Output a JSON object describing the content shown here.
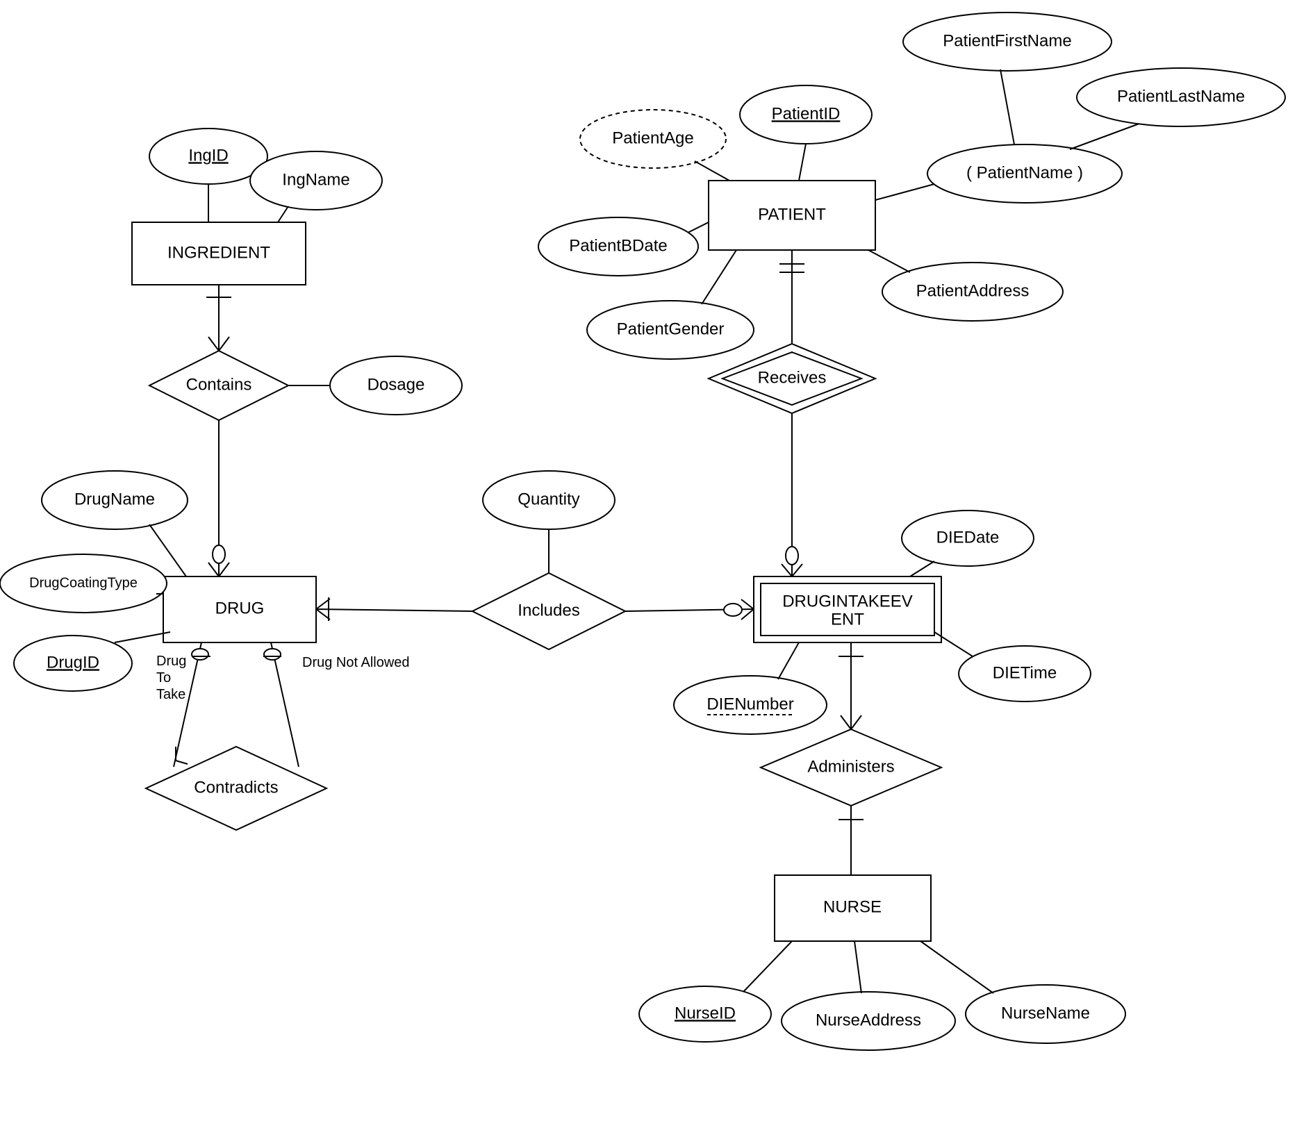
{
  "entities": {
    "ingredient": "INGREDIENT",
    "drug": "DRUG",
    "patient": "PATIENT",
    "drugintake": "DRUGINTAKEEV",
    "drugintake2": "ENT",
    "nurse": "NURSE"
  },
  "attributes": {
    "ingid": "IngID",
    "ingname": "IngName",
    "dosage": "Dosage",
    "drugname": "DrugName",
    "drugcoating": "DrugCoatingType",
    "drugid": "DrugID",
    "patientage": "PatientAge",
    "patientid": "PatientID",
    "patientfirst": "PatientFirstName",
    "patientlast": "PatientLastName",
    "patientname": "( PatientName )",
    "patientbdate": "PatientBDate",
    "patientgender": "PatientGender",
    "patientaddress": "PatientAddress",
    "quantity": "Quantity",
    "diedate": "DIEDate",
    "dietime": "DIETime",
    "dienumber": "DIENumber",
    "nurseid": "NurseID",
    "nurseaddress": "NurseAddress",
    "nursename": "NurseName"
  },
  "relationships": {
    "contains": "Contains",
    "includes": "Includes",
    "receives": "Receives",
    "administers": "Administers",
    "contradicts": "Contradicts"
  },
  "roles": {
    "drugtotake1": "Drug",
    "drugtotake2": "To",
    "drugtotake3": "Take",
    "drugnot": "Drug Not Allowed"
  }
}
